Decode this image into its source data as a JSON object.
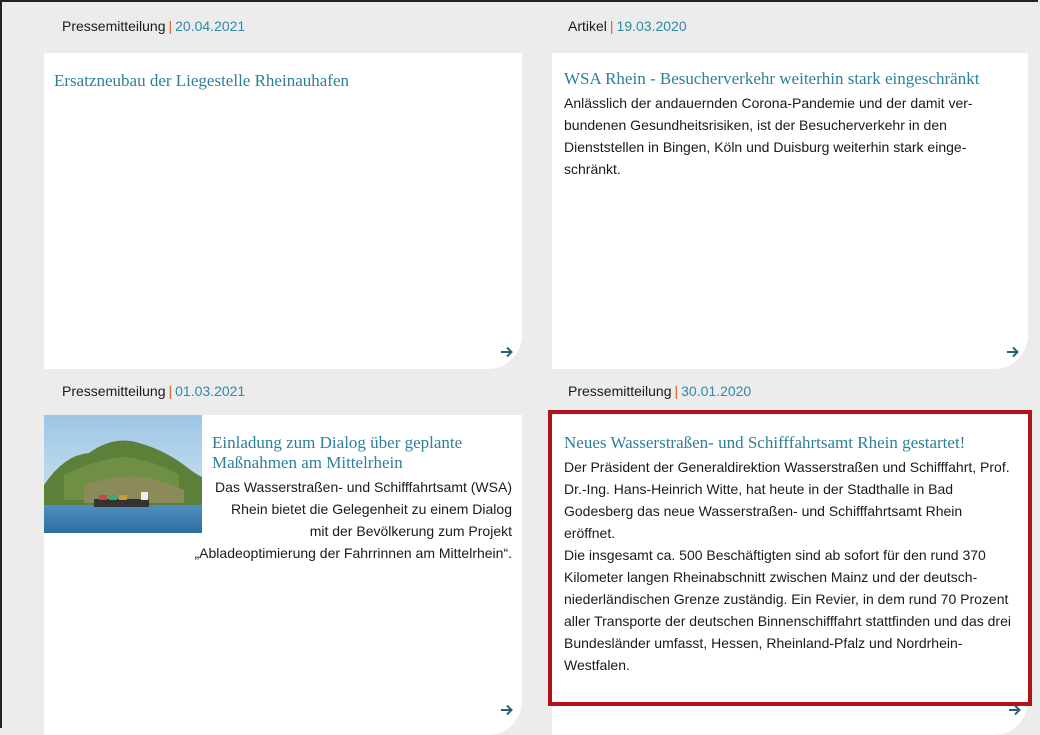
{
  "cards": [
    {
      "type": "Pressemitteilung",
      "date": "20.04.2021",
      "title": "Ersatzneubau der Liegestelle Rheinauhafen",
      "text": ""
    },
    {
      "type": "Artikel",
      "date": "19.03.2020",
      "title": "WSA Rhein - Besucherverkehr weiterhin stark einge­schränkt",
      "text": "Anlässlich der andauernden Corona-Pandemie und der damit ver­bundenen Gesundheitsrisiken, ist der Besucherverkehr in den Dienststellen in Bingen, Köln und Duisburg weiterhin stark einge­schränkt."
    },
    {
      "type": "Pressemitteilung",
      "date": "01.03.2021",
      "title": "Einladung zum Dialog über geplante Maßnahmen am Mittelrhein",
      "text": "Das Wasserstraßen- und Schifffahrtsamt (WSA) Rhein bietet die Gelegenheit zu ei­nem Dialog mit der Bevölkerung zum Pro­jekt „Abladeoptimierung der Fahrrinnen am Mittelrhein“."
    },
    {
      "type": "Pressemitteilung",
      "date": "30.01.2020",
      "title": "Neues Wasserstraßen- und Schifffahrtsamt Rhein gestartet!",
      "text": "Der Präsident der Generaldirektion Wasserstraßen und Schiff­fahrt, Prof. Dr.-Ing. Hans-Heinrich Witte, hat heute in der Stadthalle in Bad Godesberg das neue Wasserstraßen- und Schifffahrtsamt Rhein eröffnet.",
      "text2": "Die insgesamt ca. 500 Beschäftigten sind ab sofort für den rund 370 Kilometer langen Rheinabschnitt zwischen Mainz und der deutsch-niederländischen Grenze zuständig. Ein Revier, in dem rund 70 Prozent aller Transporte der deutschen Binnenschifffahrt stattfinden und das drei Bundesländer umfasst, Hessen, Rheinland-Pfalz und Nordrhein-Westfalen."
    }
  ],
  "separator": "|",
  "icons": {
    "arrow": "arrow-right-icon"
  },
  "colors": {
    "title": "#2d7f99",
    "date": "#2e8aa5",
    "separator": "#e05a1a",
    "highlight": "#b3121a"
  }
}
